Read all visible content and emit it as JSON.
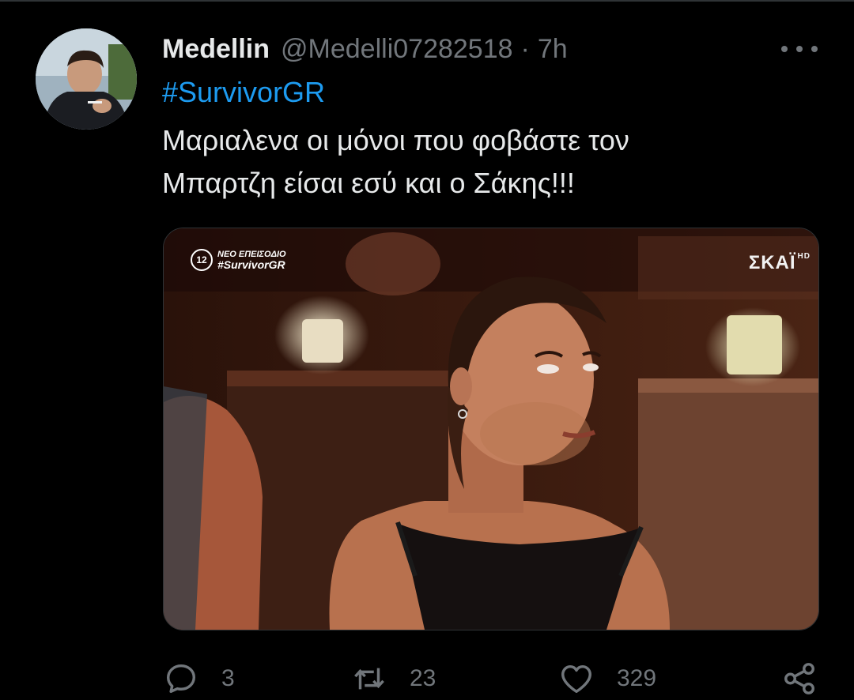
{
  "tweet": {
    "author": {
      "display_name": "Medellin",
      "handle": "@Medelli07282518",
      "avatar_icon": "user-avatar-photo"
    },
    "timestamp": "7h",
    "separator": "·",
    "hashtag": "#SurvivorGR",
    "text_lines": [
      "Μαριαλενα οι μόνοι που φοβάστε τον",
      "Μπαρτζη είσαι εσύ και ο Σάκης!!!"
    ],
    "media": {
      "tv_overlay": {
        "badge": "12",
        "line1": "ΝΕΟ ΕΠΕΙΣΟΔΙΟ",
        "line2": "#SurvivorGR"
      },
      "channel_logo": "ΣΚΑΪ",
      "channel_suffix": "HD"
    },
    "stats": {
      "replies": "3",
      "retweets": "23",
      "likes": "329"
    }
  },
  "icons": {
    "more": "more-dots-icon",
    "reply": "reply-bubble-icon",
    "retweet": "retweet-arrows-icon",
    "like": "heart-icon",
    "share": "share-nodes-icon"
  },
  "colors": {
    "background": "#000000",
    "text": "#e7e9ea",
    "muted": "#71767b",
    "link": "#1d9bf0"
  }
}
